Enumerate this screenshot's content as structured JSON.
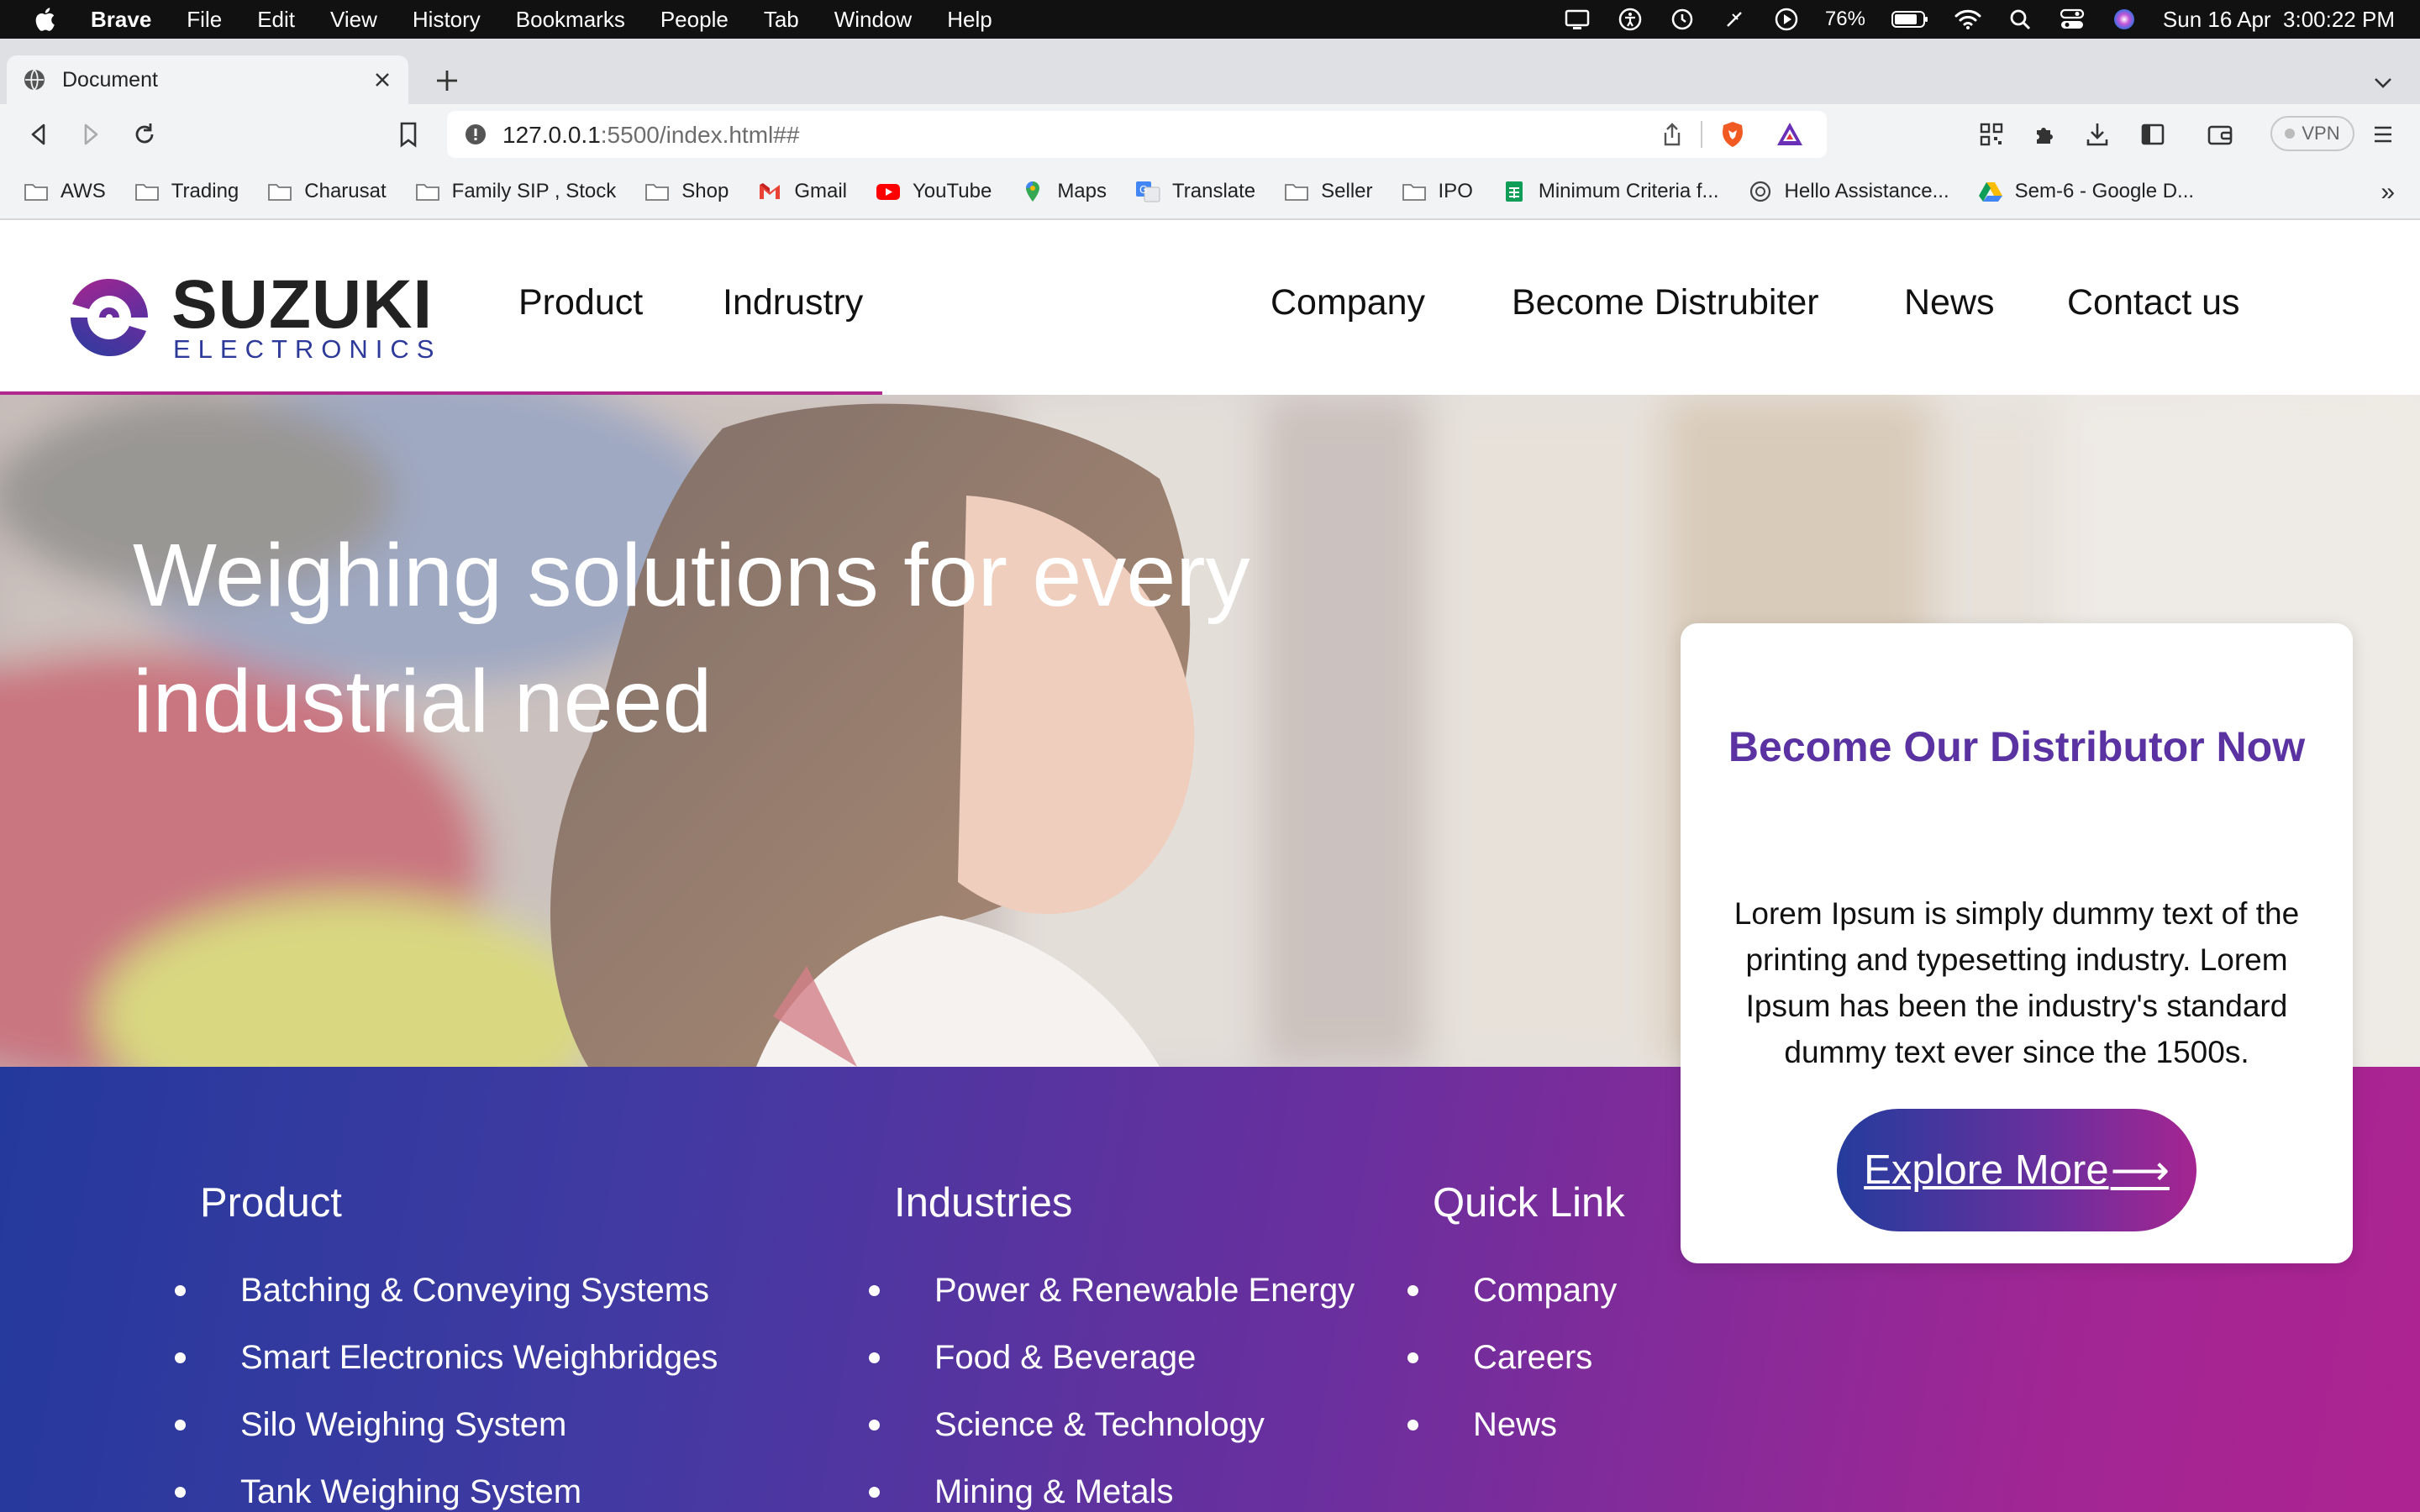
{
  "menubar": {
    "app": "Brave",
    "items": [
      "File",
      "Edit",
      "View",
      "History",
      "Bookmarks",
      "People",
      "Tab",
      "Window",
      "Help"
    ],
    "battery": "76%",
    "datetime": "Sun 16 Apr  3:00:22 PM"
  },
  "browser": {
    "tab_title": "Document",
    "url_host": "127.0.0.1",
    "url_rest": ":5500/index.html##",
    "vpn_label": "VPN"
  },
  "bookmarks": [
    {
      "label": "AWS",
      "icon": "folder-icon"
    },
    {
      "label": "Trading",
      "icon": "folder-icon"
    },
    {
      "label": "Charusat",
      "icon": "folder-icon"
    },
    {
      "label": "Family SIP , Stock",
      "icon": "folder-icon"
    },
    {
      "label": "Shop",
      "icon": "folder-icon"
    },
    {
      "label": "Gmail",
      "icon": "gmail-icon"
    },
    {
      "label": "YouTube",
      "icon": "youtube-icon"
    },
    {
      "label": "Maps",
      "icon": "maps-icon"
    },
    {
      "label": "Translate",
      "icon": "translate-icon"
    },
    {
      "label": "Seller",
      "icon": "folder-icon"
    },
    {
      "label": "IPO",
      "icon": "folder-icon"
    },
    {
      "label": "Minimum Criteria f...",
      "icon": "sheets-icon"
    },
    {
      "label": "Hello Assistance...",
      "icon": "chatgpt-icon"
    },
    {
      "label": "Sem-6 - Google D...",
      "icon": "drive-icon"
    }
  ],
  "site": {
    "logo_word": "SUZUKI",
    "logo_sub": "ELECTRONICS",
    "nav": [
      "Product",
      "Indrustry",
      "Company",
      "Become Distrubiter",
      "News",
      "Contact us"
    ],
    "hero_title": "Weighing solutions for every industrial need",
    "card": {
      "title": "Become Our Distributor Now",
      "text": "Lorem Ipsum is simply dummy text of the printing and typesetting industry. Lorem Ipsum has been the industry's standard dummy text ever since the 1500s.",
      "button": "Explore More",
      "button_arrow": "⟶"
    },
    "footer": {
      "product": {
        "heading": "Product",
        "items": [
          "Batching & Conveying Systems",
          "Smart Electronics Weighbridges",
          "Silo Weighing System",
          "Tank Weighing System"
        ]
      },
      "industries": {
        "heading": "Industries",
        "items": [
          "Power & Renewable Energy",
          "Food & Beverage",
          "Science & Technology",
          "Mining & Metals"
        ]
      },
      "quick": {
        "heading": "Quick Link",
        "items": [
          "Company",
          "Careers",
          "News"
        ]
      }
    }
  },
  "colors": {
    "brand_purple": "#5a32a2",
    "brand_blue": "#24399c",
    "brand_magenta": "#ad2391"
  }
}
